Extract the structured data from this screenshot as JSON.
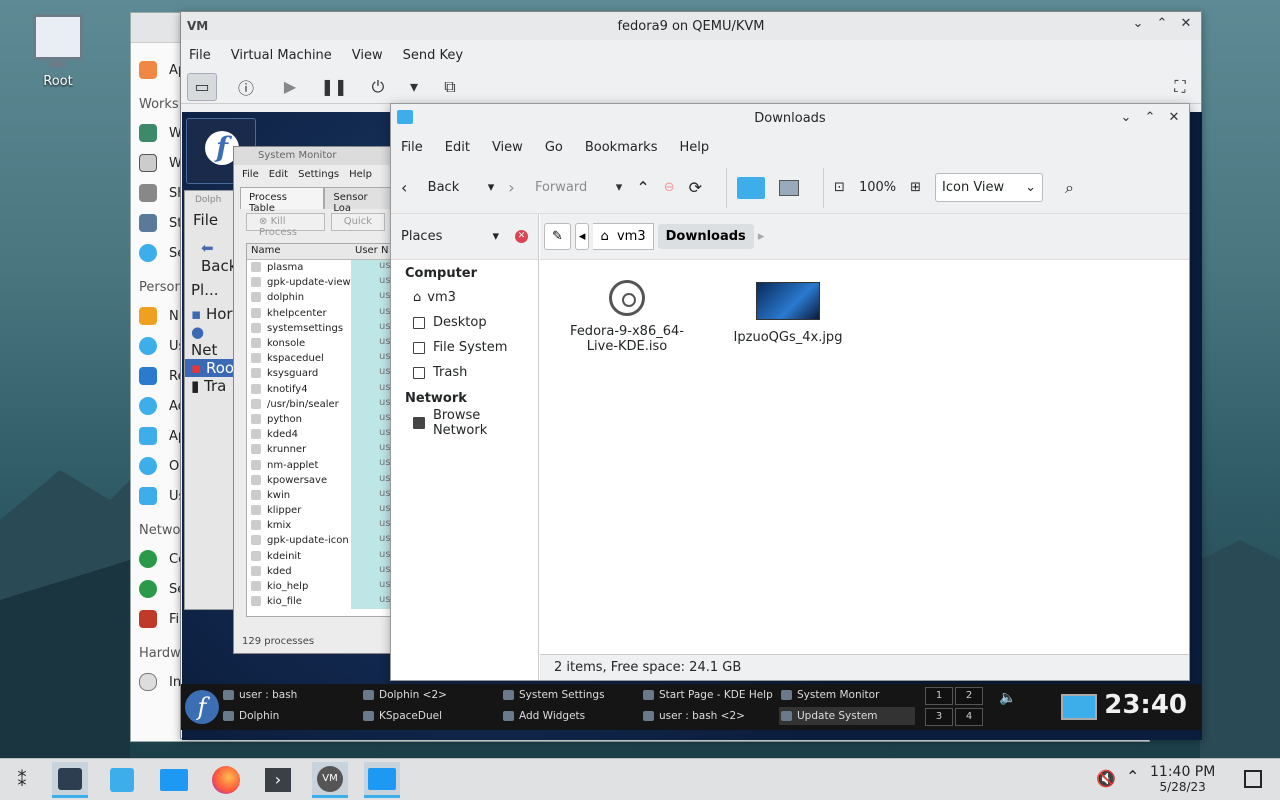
{
  "desktop": {
    "icon_label": "Root"
  },
  "system_settings": {
    "items": [
      "Ap",
      "W",
      "W",
      "Sh",
      "St",
      "Se",
      "N",
      "Us",
      "Re",
      "Ac",
      "Ap",
      "O",
      "Us",
      "Co",
      "Se",
      "Fi",
      "In"
    ],
    "headers": [
      "Works",
      "Person",
      "Netwo",
      "Hardw"
    ]
  },
  "vm_window": {
    "title": "fedora9 on QEMU/KVM",
    "menu": [
      "File",
      "Virtual Machine",
      "View",
      "Send Key"
    ]
  },
  "guest_dolphin": {
    "menu": "File",
    "back": "Back",
    "places": "Pl...",
    "items": [
      "Hor",
      "Net",
      "Roo",
      "Tra"
    ],
    "title": "Dolph"
  },
  "system_monitor": {
    "title": "System Monitor",
    "menu": [
      "File",
      "Edit",
      "Settings",
      "Help"
    ],
    "tabs": [
      "Process Table",
      "Sensor Loa"
    ],
    "buttons": [
      "Kill Process",
      "Quick"
    ],
    "columns": [
      "Name",
      "User N"
    ],
    "rows": [
      "plasma",
      "gpk-update-view",
      "dolphin",
      "khelpcenter",
      "systemsettings",
      "konsole",
      "kspaceduel",
      "ksysguard",
      "knotify4",
      "/usr/bin/sealer",
      "python",
      "kded4",
      "krunner",
      "nm-applet",
      "kpowersave",
      "kwin",
      "klipper",
      "kmix",
      "gpk-update-icon",
      "kdeinit",
      "kded",
      "kio_help",
      "kio_file"
    ],
    "user_value": "us",
    "footer": "129 processes"
  },
  "dolphin": {
    "title": "Downloads",
    "menu": [
      "File",
      "Edit",
      "View",
      "Go",
      "Bookmarks",
      "Help"
    ],
    "toolbar": {
      "back": "Back",
      "forward": "Forward",
      "zoom": "100%",
      "view_mode": "Icon View"
    },
    "places_label": "Places",
    "sections": [
      {
        "title": "Computer",
        "items": [
          "vm3",
          "Desktop",
          "File System",
          "Trash"
        ]
      },
      {
        "title": "Network",
        "items": [
          "Browse Network"
        ]
      }
    ],
    "breadcrumb": {
      "home": "vm3",
      "current": "Downloads"
    },
    "files": [
      {
        "name": "Fedora-9-x86_64-Live-KDE.iso",
        "line1": "Fedora-9-x86_64-",
        "line2": "Live-KDE.iso"
      },
      {
        "name": "IpzuoQGs_4x.jpg"
      }
    ],
    "status": "2 items, Free space: 24.1 GB"
  },
  "guest_taskbar": {
    "tasks": [
      {
        "label": "user : bash"
      },
      {
        "label": "Dolphin"
      },
      {
        "label": "Dolphin <2>"
      },
      {
        "label": "KSpaceDuel"
      },
      {
        "label": "System Settings"
      },
      {
        "label": "Add Widgets"
      },
      {
        "label": "Start Page - KDE Help"
      },
      {
        "label": "user : bash <2>"
      },
      {
        "label": "System Monitor"
      },
      {
        "label": "Update System"
      }
    ],
    "pager": [
      "1",
      "2",
      "3",
      "4"
    ],
    "clock": "23:40"
  },
  "host_taskbar": {
    "time": "11:40 PM",
    "date": "5/28/23"
  }
}
